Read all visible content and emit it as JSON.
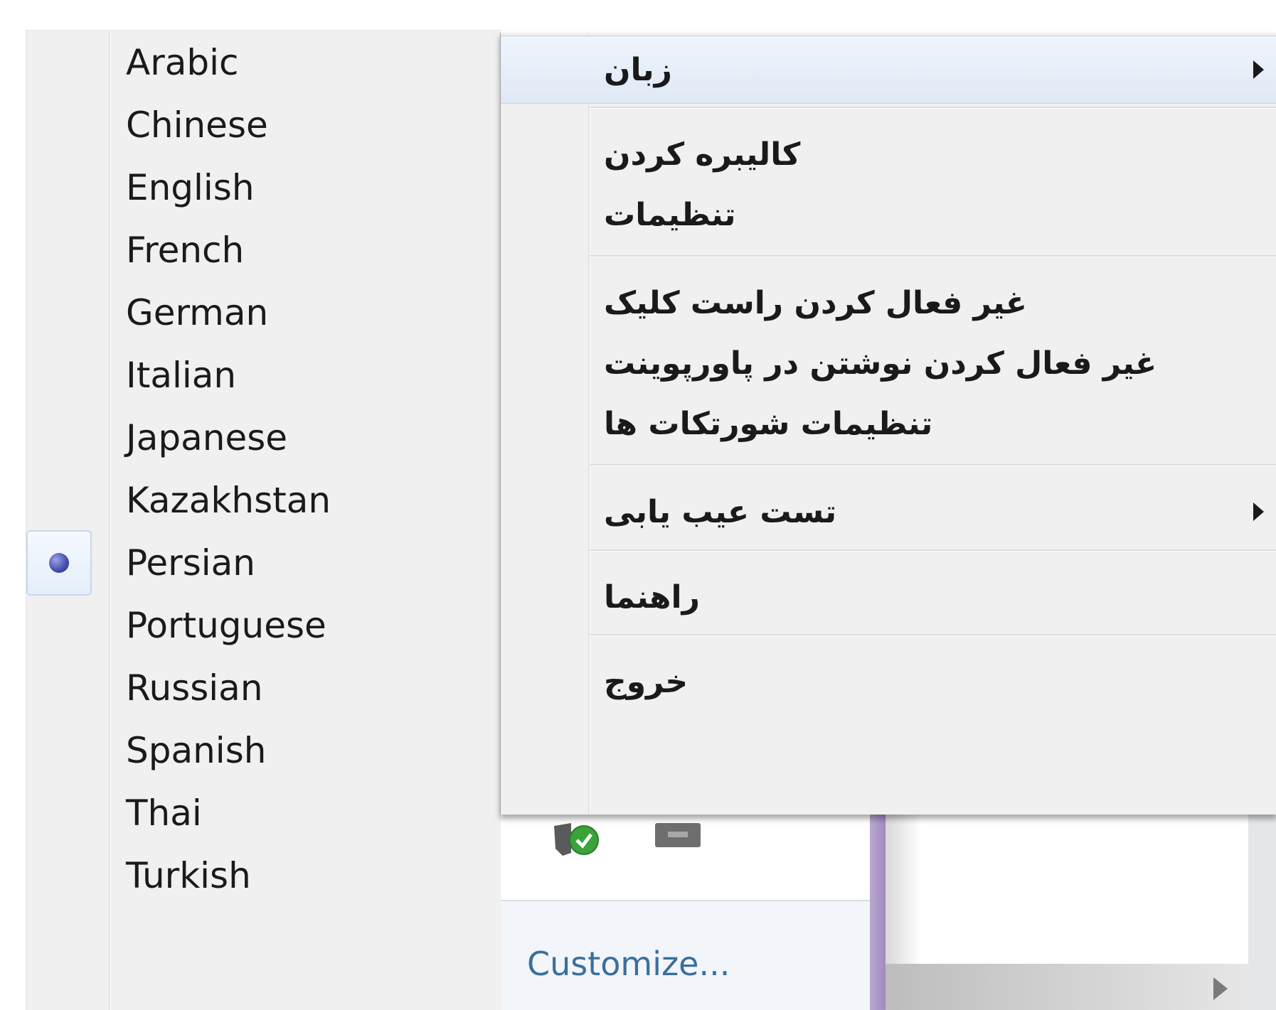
{
  "language_menu": {
    "items": [
      {
        "label": "Arabic",
        "selected": false
      },
      {
        "label": "Chinese",
        "selected": false
      },
      {
        "label": "English",
        "selected": false
      },
      {
        "label": "French",
        "selected": false
      },
      {
        "label": "German",
        "selected": false
      },
      {
        "label": "Italian",
        "selected": false
      },
      {
        "label": "Japanese",
        "selected": false
      },
      {
        "label": "Kazakhstan",
        "selected": false
      },
      {
        "label": "Persian",
        "selected": true
      },
      {
        "label": "Portuguese",
        "selected": false
      },
      {
        "label": "Russian",
        "selected": false
      },
      {
        "label": "Spanish",
        "selected": false
      },
      {
        "label": "Thai",
        "selected": false
      },
      {
        "label": "Turkish",
        "selected": false
      }
    ],
    "selected_indicator_icon": "radio-dot-icon"
  },
  "context_menu": {
    "items": [
      {
        "label": "زبان",
        "has_submenu": true,
        "highlighted": true
      },
      {
        "label": "کالیبره کردن",
        "has_submenu": false,
        "highlighted": false
      },
      {
        "label": "تنظیمات",
        "has_submenu": false,
        "highlighted": false
      },
      {
        "label": "غیر فعال کردن راست کلیک",
        "has_submenu": false,
        "highlighted": false
      },
      {
        "label": "غیر فعال کردن نوشتن در پاورپوینت",
        "has_submenu": false,
        "highlighted": false
      },
      {
        "label": "تنظیمات شورتکات ها",
        "has_submenu": false,
        "highlighted": false
      },
      {
        "label": "تست عیب یابی",
        "has_submenu": true,
        "highlighted": false
      },
      {
        "label": "راهنما",
        "has_submenu": false,
        "highlighted": false
      },
      {
        "label": "خروج",
        "has_submenu": false,
        "highlighted": false
      }
    ]
  },
  "tray": {
    "customize_label": "Customize...",
    "icons": [
      "security-check-icon",
      "network-icon"
    ]
  },
  "colors": {
    "menu_background": "#f0f0f0",
    "highlight_background": "#dfe9f5",
    "link_color": "#3a6f9a",
    "radio_color": "#4a52b0"
  }
}
